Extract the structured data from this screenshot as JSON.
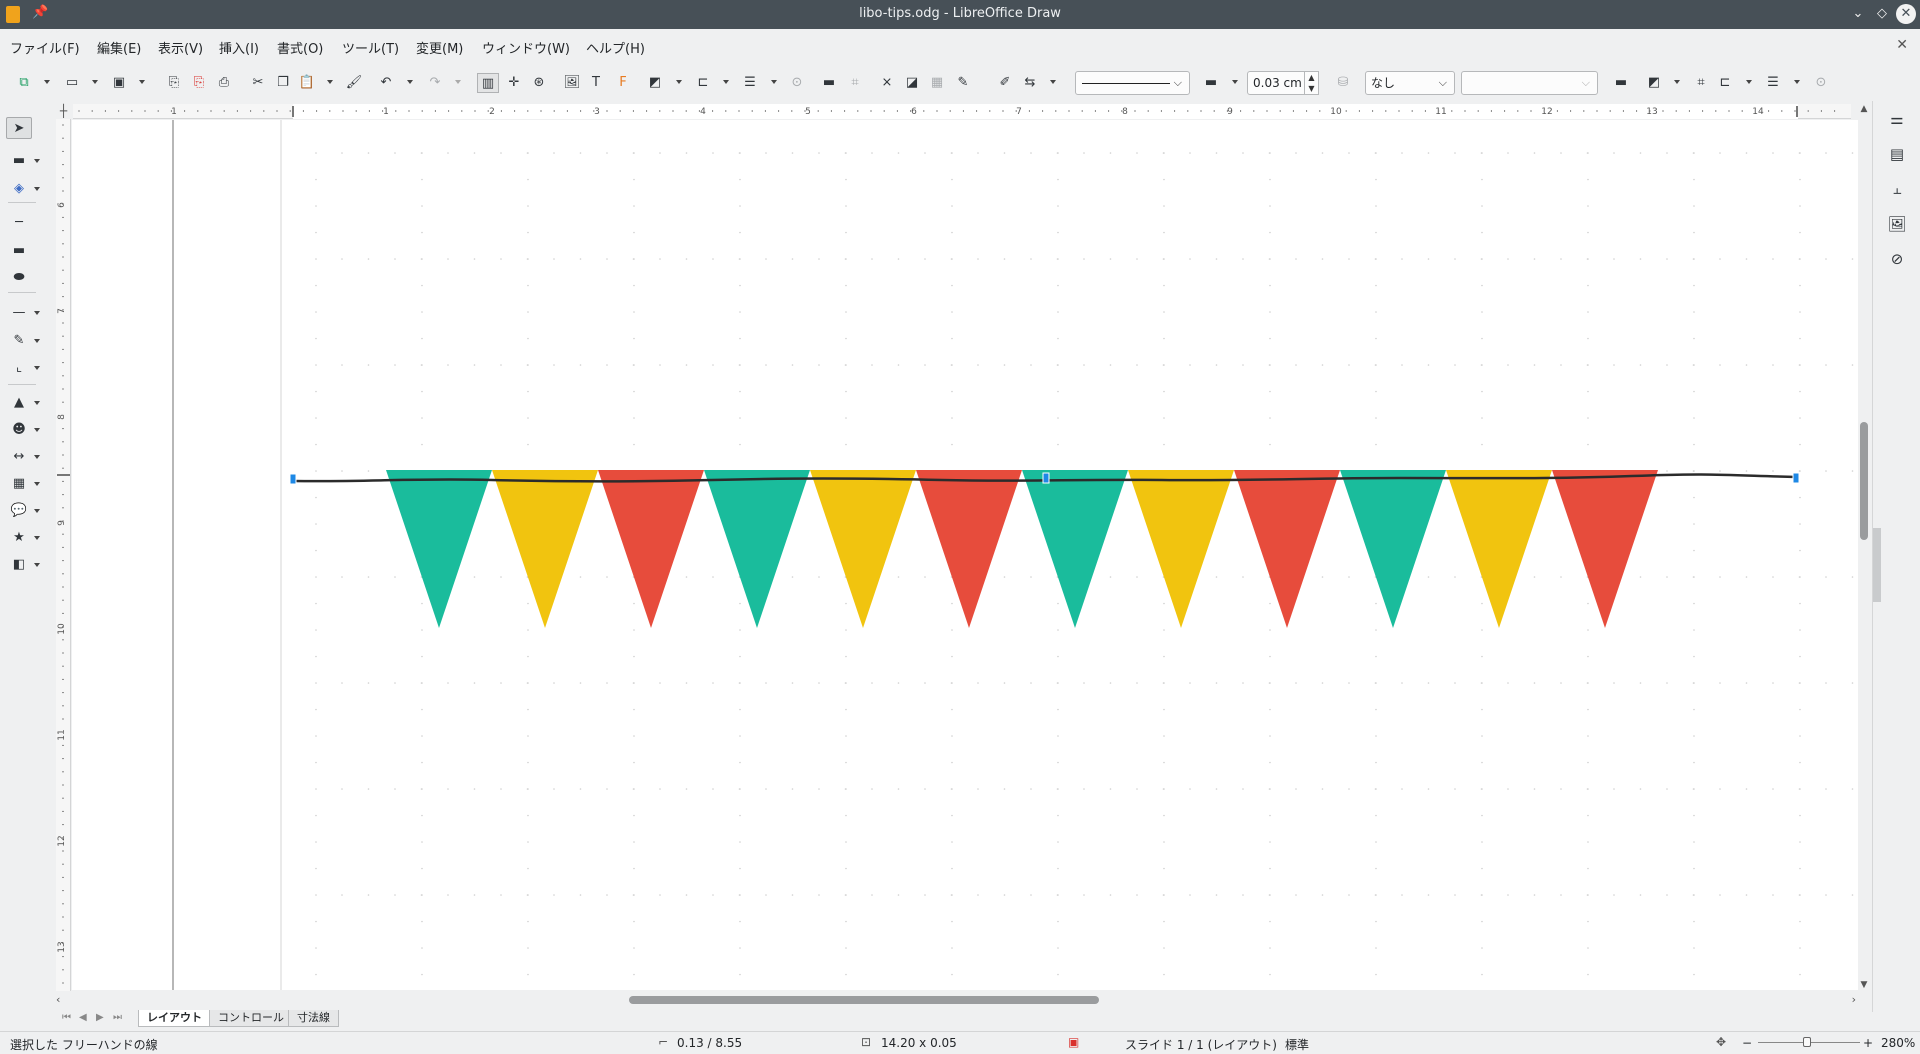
{
  "window": {
    "title": "libo-tips.odg - LibreOffice Draw"
  },
  "menu": [
    "ファイル(F)",
    "編集(E)",
    "表示(V)",
    "挿入(I)",
    "書式(O)",
    "ツール(T)",
    "変更(M)",
    "ウィンドウ(W)",
    "ヘルプ(H)"
  ],
  "toolbar": {
    "line_width": "0.03 cm",
    "area_style": "なし",
    "area_fill": ""
  },
  "icons": {
    "pin": "pin-icon",
    "minimize": "chevron-down-icon",
    "maximize": "diamond-icon",
    "close": "close-icon",
    "select": "arrow-pointer-icon",
    "line_color": "line-color-icon",
    "fill_color": "fill-color-icon"
  },
  "rulers": {
    "horizontal": [
      "1",
      "1",
      "2",
      "3",
      "4",
      "5",
      "6",
      "7",
      "8",
      "9",
      "10",
      "11",
      "12",
      "13",
      "14"
    ],
    "vertical": [
      "6",
      "7",
      "8",
      "9",
      "10",
      "11",
      "12",
      "13"
    ]
  },
  "drawing": {
    "line_color": "#2b2b2b",
    "handle_color": "#1e88e5",
    "pennant_colors": [
      "#1abc9c",
      "#f1c40f",
      "#e74c3c"
    ],
    "pennant_count": 12
  },
  "tabs": [
    "レイアウト",
    "コントロール",
    "寸法線"
  ],
  "status": {
    "selection": "選択した フリーハンドの線",
    "position": "0.13 / 8.55",
    "size": "14.20 x 0.05",
    "slide": "スライド 1 / 1 (レイアウト)",
    "master": "標準",
    "zoom_minus": "−",
    "zoom_plus": "+",
    "zoom": "280%"
  }
}
